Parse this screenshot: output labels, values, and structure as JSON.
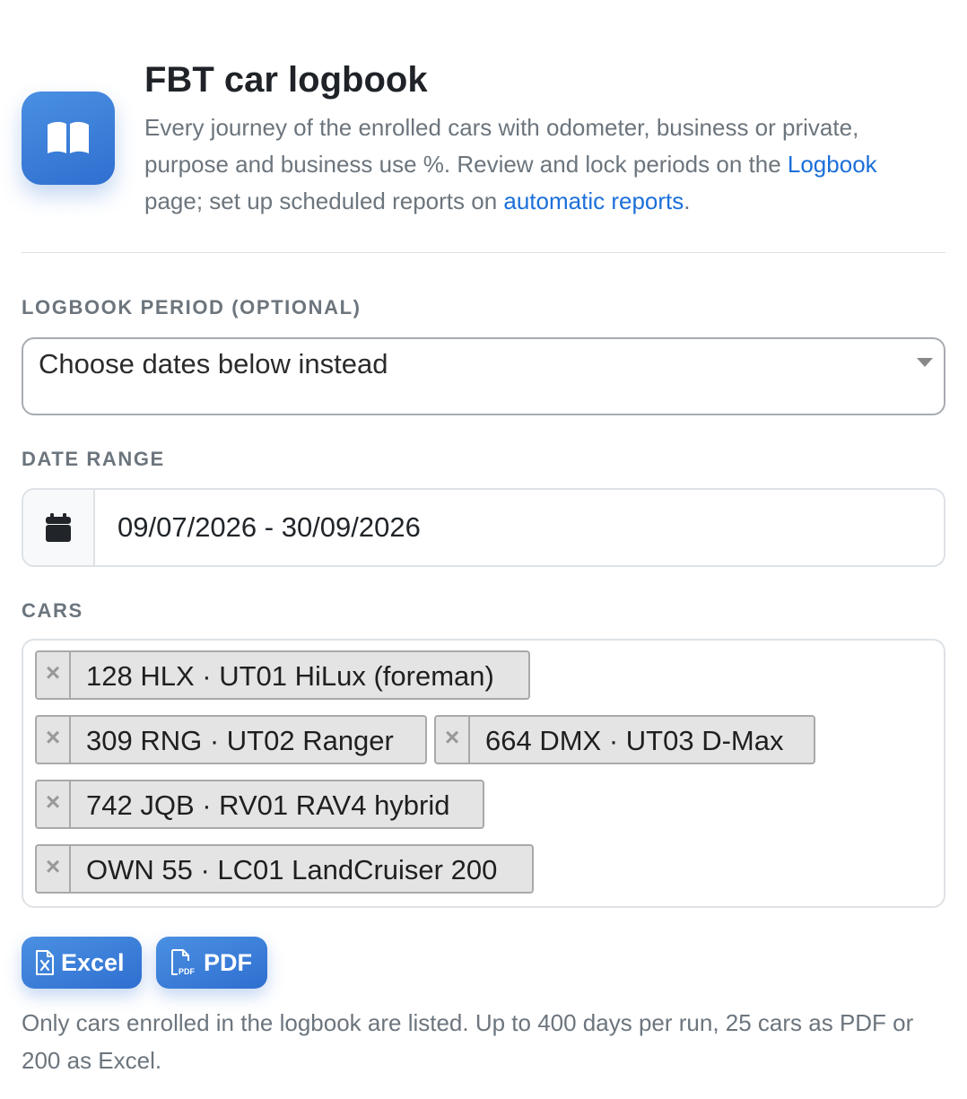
{
  "header": {
    "icon": "open-book-icon",
    "title": "FBT car logbook",
    "description_before_link1": "Every journey of the enrolled cars with odometer, business or private, purpose and business use %. Review and lock periods on the ",
    "link1": "Logbook",
    "description_between_links": " page; set up scheduled reports on ",
    "link2": "automatic reports",
    "description_after_link2": "."
  },
  "period": {
    "label": "LOGBOOK PERIOD (OPTIONAL)",
    "selected": "Choose dates below instead"
  },
  "date_range": {
    "label": "DATE RANGE",
    "icon": "calendar-icon",
    "value": "09/07/2026 - 30/09/2026"
  },
  "cars": {
    "label": "CARS",
    "remove_glyph": "×",
    "selected": [
      "128 HLX · UT01 HiLux (foreman)",
      "309 RNG · UT02 Ranger",
      "664 DMX · UT03 D-Max",
      "742 JQB · RV01 RAV4 hybrid",
      "OWN 55 · LC01 LandCruiser 200"
    ]
  },
  "actions": {
    "excel_label": "Excel",
    "excel_icon": "excel-file-icon",
    "pdf_label": "PDF",
    "pdf_icon": "pdf-file-icon"
  },
  "footnote": "Only cars enrolled in the logbook are listed. Up to 400 days per run, 25 cars as PDF or 200 as Excel.",
  "colors": {
    "accent": "#2f6fd0",
    "link": "#1b6fd9",
    "muted_text": "#6c757d"
  }
}
